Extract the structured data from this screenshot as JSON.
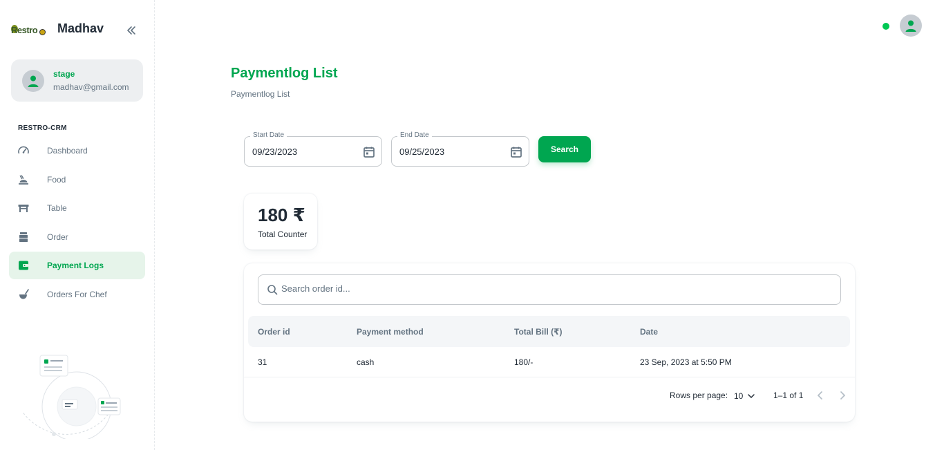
{
  "sidebar": {
    "logo_text": "Restro",
    "brand_name": "Madhav",
    "account": {
      "name": "stage",
      "email": "madhav@gmail.com"
    },
    "section_label": "RESTRO-CRM",
    "items": [
      {
        "label": "Dashboard",
        "icon": "dashboard-icon"
      },
      {
        "label": "Food",
        "icon": "food-icon"
      },
      {
        "label": "Table",
        "icon": "table-icon"
      },
      {
        "label": "Order",
        "icon": "order-icon"
      },
      {
        "label": "Payment Logs",
        "icon": "wallet-icon",
        "active": true
      },
      {
        "label": "Orders For Chef",
        "icon": "chef-icon"
      }
    ]
  },
  "header": {
    "status": "online"
  },
  "page": {
    "title": "Paymentlog List",
    "breadcrumb": "Paymentlog List"
  },
  "filters": {
    "start_label": "Start Date",
    "start_value": "09/23/2023",
    "end_label": "End Date",
    "end_value": "09/25/2023",
    "search_label": "Search"
  },
  "counter": {
    "value": "180 ₹",
    "label": "Total Counter"
  },
  "table": {
    "search_placeholder": "Search order id...",
    "columns": [
      "Order id",
      "Payment method",
      "Total Bill (₹)",
      "Date"
    ],
    "rows": [
      [
        "31",
        "cash",
        "180/-",
        "23 Sep, 2023 at 5:50 PM"
      ]
    ],
    "pagination": {
      "rows_per_page_label": "Rows per page:",
      "rows_per_page": "10",
      "range": "1–1 of 1"
    }
  },
  "colors": {
    "accent": "#00a650",
    "active_bg": "#e6f4ea",
    "text": "#212b36",
    "muted": "#637381"
  }
}
